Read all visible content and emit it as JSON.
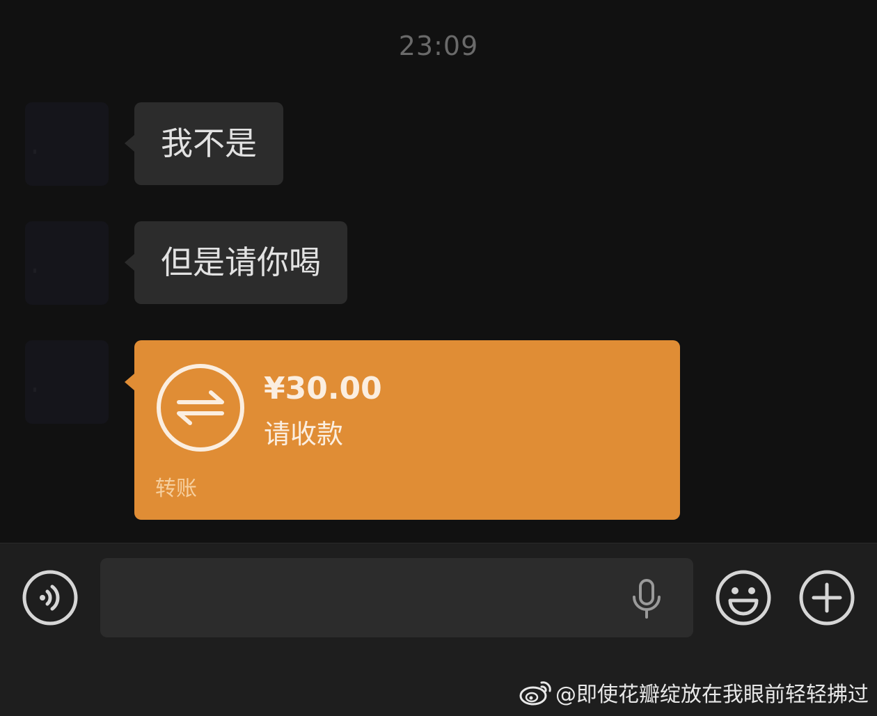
{
  "chat": {
    "timestamp": "23:09",
    "messages": [
      {
        "type": "text",
        "text": "我不是"
      },
      {
        "type": "text",
        "text": "但是请你喝"
      },
      {
        "type": "transfer",
        "amount": "¥30.00",
        "status": "请收款",
        "footer": "转账"
      }
    ]
  },
  "input_bar": {
    "voice_icon": "voice-toggle-icon",
    "text_value": "",
    "mic_icon": "microphone-icon",
    "emoji_icon": "smiley-icon",
    "more_icon": "plus-icon"
  },
  "watermark": {
    "icon": "weibo-logo-icon",
    "text": "@即使花瓣绽放在我眼前轻轻拂过"
  },
  "colors": {
    "background": "#111111",
    "bubble": "#2c2c2c",
    "transfer": "#e08d35",
    "input_bar": "#1e1e1e"
  }
}
